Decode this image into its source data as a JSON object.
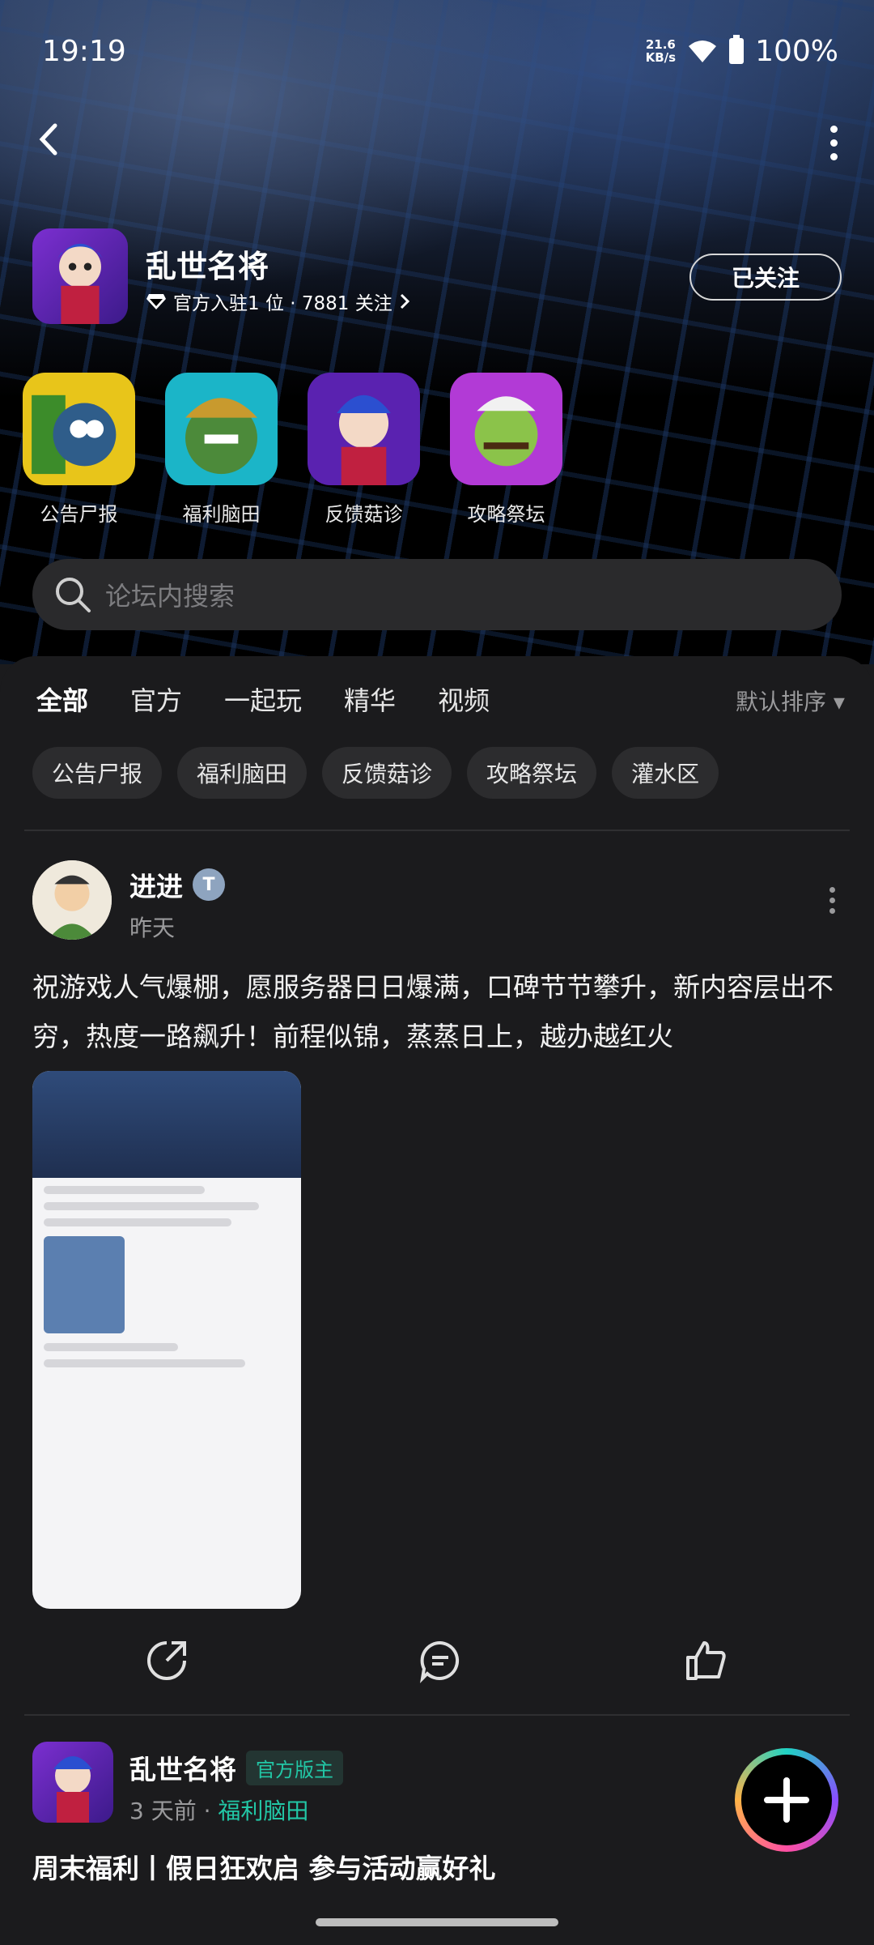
{
  "status_bar": {
    "time": "19:19",
    "speed_value": "21.6",
    "speed_unit": "KB/s",
    "battery": "100%"
  },
  "header": {
    "game_title": "乱世名将",
    "subtitle": "官方入驻1 位 · 7881 关注",
    "follow_label": "已关注"
  },
  "quick_links": [
    {
      "label": "公告尸报"
    },
    {
      "label": "福利脑田"
    },
    {
      "label": "反馈菇诊"
    },
    {
      "label": "攻略祭坛"
    }
  ],
  "search": {
    "placeholder": "论坛内搜索"
  },
  "tabs": [
    "全部",
    "官方",
    "一起玩",
    "精华",
    "视频"
  ],
  "sort_label": "默认排序 ▾",
  "chips": [
    "公告尸报",
    "福利脑田",
    "反馈菇诊",
    "攻略祭坛",
    "灌水区"
  ],
  "post1": {
    "author": "进进",
    "time": "昨天",
    "text": "祝游戏人气爆棚，愿服务器日日爆满，口碑节节攀升，新内容层出不穷，热度一路飙升！前程似锦，蒸蒸日上，越办越红火"
  },
  "post2": {
    "author": "乱世名将",
    "badge": "官方版主",
    "time": "3 天前 · ",
    "category": "福利脑田",
    "title": "周末福利丨假日狂欢启 参与活动赢好礼"
  },
  "colors": {
    "accent": "#22c7a6",
    "background": "#1b1b1d"
  }
}
